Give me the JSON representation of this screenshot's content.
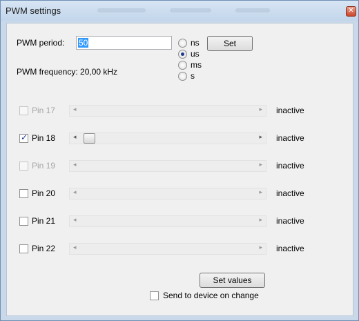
{
  "window": {
    "title": "PWM settings",
    "close_glyph": "✕"
  },
  "period": {
    "label": "PWM period:",
    "value": "50",
    "units": [
      {
        "label": "ns",
        "selected": false
      },
      {
        "label": "us",
        "selected": true
      },
      {
        "label": "ms",
        "selected": false
      },
      {
        "label": "s",
        "selected": false
      }
    ],
    "set_label": "Set"
  },
  "frequency": {
    "text": "PWM frequency: 20,00 kHz"
  },
  "pins": [
    {
      "label": "Pin 17",
      "checked": false,
      "enabled": false,
      "status": "inactive",
      "slider_value": 0
    },
    {
      "label": "Pin 18",
      "checked": true,
      "enabled": true,
      "status": "inactive",
      "slider_value": 0
    },
    {
      "label": "Pin 19",
      "checked": false,
      "enabled": false,
      "status": "inactive",
      "slider_value": 0
    },
    {
      "label": "Pin 20",
      "checked": false,
      "enabled": true,
      "status": "inactive",
      "slider_value": 0
    },
    {
      "label": "Pin 21",
      "checked": false,
      "enabled": true,
      "status": "inactive",
      "slider_value": 0
    },
    {
      "label": "Pin 22",
      "checked": false,
      "enabled": true,
      "status": "inactive",
      "slider_value": 0
    }
  ],
  "arrows": {
    "left": "◂",
    "right": "▸"
  },
  "footer": {
    "set_values_label": "Set values",
    "send_on_change_label": "Send to device on change",
    "send_on_change_checked": false
  },
  "colors": {
    "title_bar": "#c9d9ea",
    "selection": "#3399ff",
    "client_bg": "#f0f0f0"
  }
}
